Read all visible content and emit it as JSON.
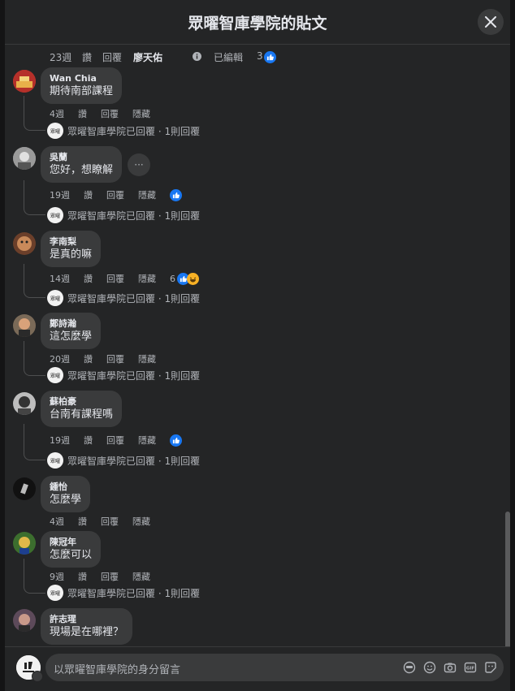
{
  "header": {
    "title": "眾曜智庫學院的貼文"
  },
  "top_meta": {
    "age": "23週",
    "like": "讚",
    "reply": "回覆",
    "author": "廖天佑",
    "edited": "已編輯",
    "reaction_count": "3"
  },
  "actions": {
    "like": "讚",
    "reply": "回覆",
    "hide": "隱藏"
  },
  "comments": [
    {
      "name": "Wan Chia",
      "text": "期待南部課程",
      "age": "4週",
      "reactions": "",
      "reply": "眾曜智庫學院已回覆 · 1則回覆"
    },
    {
      "name": "吳蘭",
      "text": "您好，想瞭解",
      "age": "19週",
      "reactions": "",
      "reply": "眾曜智庫學院已回覆 · 1則回覆"
    },
    {
      "name": "李南梨",
      "text": "是真的嘛",
      "age": "14週",
      "reactions": "6",
      "reply": "眾曜智庫學院已回覆 · 1則回覆"
    },
    {
      "name": "鄭詩瀚",
      "text": "這怎麼學",
      "age": "20週",
      "reactions": "",
      "reply": "眾曜智庫學院已回覆 · 1則回覆"
    },
    {
      "name": "蘇柏豪",
      "text": "台南有課程嗎",
      "age": "19週",
      "reactions": "",
      "reply": "眾曜智庫學院已回覆 · 1則回覆"
    },
    {
      "name": "鍾怡",
      "text": "怎麼學",
      "age": "4週",
      "reactions": "",
      "reply": ""
    },
    {
      "name": "陳冠年",
      "text": "怎麼可以",
      "age": "9週",
      "reactions": "",
      "reply": "眾曜智庫學院已回覆 · 1則回覆"
    },
    {
      "name": "許志瑆",
      "text": "現場是在哪裡？",
      "age": "",
      "reactions": "",
      "reply": ""
    }
  ],
  "composer": {
    "placeholder": "以眾曜智庫學院的身分留言"
  },
  "icons": [
    "close-icon",
    "like-icon",
    "haha-icon",
    "more-icon",
    "avatar-sticker-icon",
    "emoji-icon",
    "camera-icon",
    "gif-icon",
    "sticker-icon",
    "info-icon"
  ],
  "colors": {
    "background": "#242526",
    "bubble": "#3a3b3c",
    "like_blue": "#1877f2",
    "text_secondary": "#b0b3b8"
  }
}
